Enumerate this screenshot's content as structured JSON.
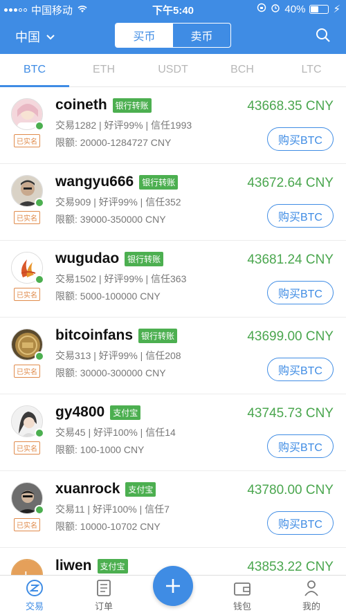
{
  "status_bar": {
    "carrier": "中国移动",
    "time": "下午5:40",
    "battery": "40%"
  },
  "header": {
    "region": "中国",
    "buy_tab": "买币",
    "sell_tab": "卖币"
  },
  "tabs": [
    {
      "label": "BTC",
      "active": true
    },
    {
      "label": "ETH"
    },
    {
      "label": "USDT"
    },
    {
      "label": "BCH"
    },
    {
      "label": "LTC"
    }
  ],
  "listings": [
    {
      "name": "coineth",
      "method": "银行转账",
      "stats": "交易1282 | 好评99% | 信任1993",
      "limit": "限额: 20000-1284727 CNY",
      "price": "43668.35 CNY",
      "verified": "已实名",
      "button": "购买BTC"
    },
    {
      "name": "wangyu666",
      "method": "银行转账",
      "stats": "交易909 | 好评99% | 信任352",
      "limit": "限额: 39000-350000 CNY",
      "price": "43672.64 CNY",
      "verified": "已实名",
      "button": "购买BTC"
    },
    {
      "name": "wugudao",
      "method": "银行转账",
      "stats": "交易1502 | 好评99% | 信任363",
      "limit": "限额: 5000-100000 CNY",
      "price": "43681.24 CNY",
      "verified": "已实名",
      "button": "购买BTC"
    },
    {
      "name": "bitcoinfans",
      "method": "银行转账",
      "stats": "交易313 | 好评99% | 信任208",
      "limit": "限额: 30000-300000 CNY",
      "price": "43699.00 CNY",
      "verified": "已实名",
      "button": "购买BTC"
    },
    {
      "name": "gy4800",
      "method": "支付宝",
      "stats": "交易45 | 好评100% | 信任14",
      "limit": "限额: 100-1000 CNY",
      "price": "43745.73 CNY",
      "verified": "已实名",
      "button": "购买BTC"
    },
    {
      "name": "xuanrock",
      "method": "支付宝",
      "stats": "交易11 | 好评100% | 信任7",
      "limit": "限额: 10000-10702 CNY",
      "price": "43780.00 CNY",
      "verified": "已实名",
      "button": "购买BTC"
    },
    {
      "name": "liwen",
      "method": "支付宝",
      "stats": "",
      "limit": "",
      "price": "43853.22 CNY",
      "verified": "",
      "button": ""
    }
  ],
  "bottom_nav": {
    "trade": "交易",
    "orders": "订单",
    "wallet": "钱包",
    "mine": "我的"
  },
  "colors": {
    "primary": "#3f8ce4",
    "price_green": "#4aa64e",
    "online": "#4caf50",
    "verified": "#e08a4a"
  }
}
